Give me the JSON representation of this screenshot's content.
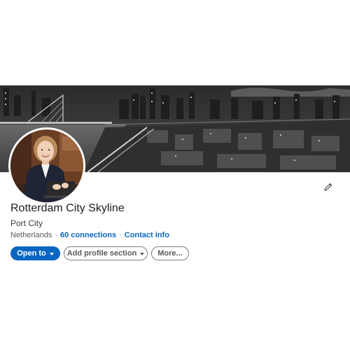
{
  "cover": {
    "description_icon": "city-skyline-cover-image"
  },
  "profile": {
    "name": "Rotterdam City Skyline",
    "headline": "Port City",
    "location": "Netherlands",
    "separator": "·",
    "connections": "60 connections",
    "contact_info": "Contact info",
    "avatar_icon": "profile-photo"
  },
  "edit": {
    "icon": "pencil-icon"
  },
  "actions": {
    "open_to": "Open to",
    "add_profile_section": "Add profile section",
    "more": "More..."
  },
  "colors": {
    "accent": "#0a66c2",
    "text": "#1d1d1d",
    "muted": "#5a5a5a"
  }
}
